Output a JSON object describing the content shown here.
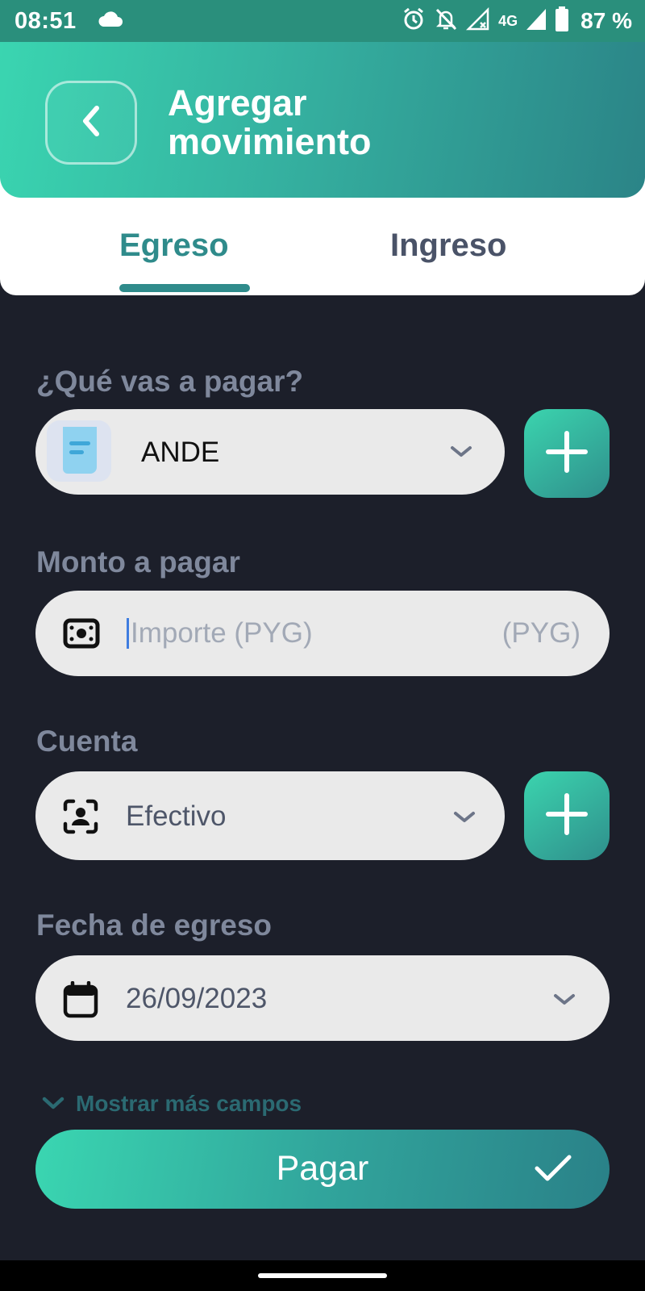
{
  "status_bar": {
    "time": "08:51",
    "network": "4G",
    "battery": "87 %"
  },
  "header": {
    "title_line1": "Agregar",
    "title_line2": "movimiento"
  },
  "tabs": {
    "expense": "Egreso",
    "income": "Ingreso",
    "active": "Egreso"
  },
  "form": {
    "category": {
      "label": "¿Qué vas a pagar?",
      "value": "ANDE"
    },
    "amount": {
      "label": "Monto a pagar",
      "placeholder": "Importe (PYG)",
      "currency": "(PYG)"
    },
    "account": {
      "label": "Cuenta",
      "value": "Efectivo"
    },
    "date": {
      "label": "Fecha de egreso",
      "value": "26/09/2023"
    }
  },
  "more_fields": "Mostrar más campos",
  "submit": "Pagar",
  "colors": {
    "accent": "#2f8b8b",
    "gradient_start": "#3ad6b1",
    "gradient_end": "#2a8188",
    "background": "#1c1f2a",
    "field": "#eaeaea"
  },
  "icons": {
    "back": "chevron-left-icon",
    "category": "receipt-icon",
    "amount": "banknote-icon",
    "account": "face-scan-icon",
    "date": "calendar-icon",
    "add": "plus-icon",
    "dropdown": "chevron-down-icon",
    "submit": "check-icon"
  }
}
